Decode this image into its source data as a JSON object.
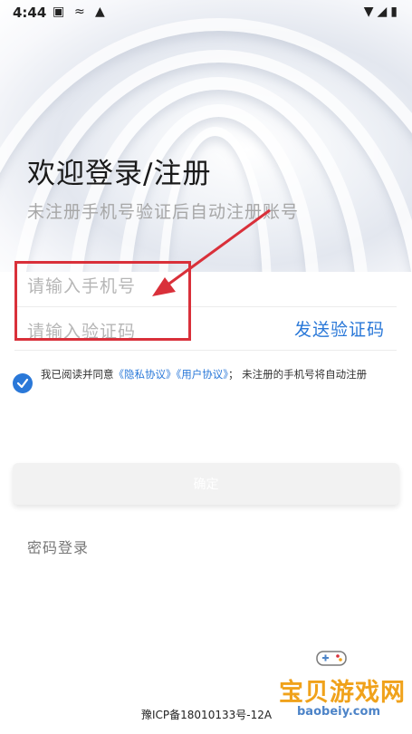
{
  "status_bar": {
    "time": "4:44"
  },
  "header": {
    "title": "欢迎登录/注册",
    "subtitle": "未注册手机号验证后自动注册账号"
  },
  "form": {
    "phone_placeholder": "请输入手机号",
    "code_placeholder": "请输入验证码",
    "send_code_label": "发送验证码",
    "agreement": {
      "prefix": "我已阅读并同意",
      "privacy_link": "《隐私协议》",
      "user_link": "《用户协议》",
      "suffix": "；  未注册的手机号将自动注册",
      "checked": true
    },
    "confirm_label": "确定"
  },
  "alt_login_label": "密码登录",
  "footer": {
    "icp": "豫ICP备18010133号-12A"
  },
  "watermark": {
    "brand": "宝贝游戏网",
    "site": "baobeiy.com"
  },
  "colors": {
    "accent": "#2a78d8",
    "annotation": "#d9303a",
    "watermark": "#f0a21b"
  }
}
